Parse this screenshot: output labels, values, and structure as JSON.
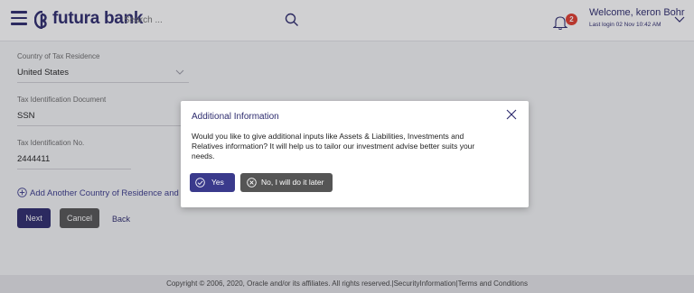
{
  "header": {
    "logo_text": "futura bank",
    "search_placeholder": "Search ...",
    "notification_count": "2",
    "welcome": "Welcome, keron Bohr",
    "last_login": "Last login 02 Nov 10:42 AM"
  },
  "form": {
    "country_label": "Country of Tax Residence",
    "country_value": "United States",
    "doc_label": "Tax Identification Document",
    "doc_value": "SSN",
    "tin_label": "Tax Identification No.",
    "tin_value": "2444411",
    "add_link": "Add Another Country of Residence and Tax",
    "next_label": "Next",
    "cancel_label": "Cancel",
    "back_label": "Back"
  },
  "modal": {
    "title": "Additional Information",
    "body": "Would you like to give additional inputs like Assets & Liabilities, Investments and Relatives information? It will help us to tailor our investment advise better suits your needs.",
    "yes_label": "Yes",
    "later_label": "No, I will do it later"
  },
  "footer": {
    "text": "Copyright © 2006, 2020, Oracle and/or its affiliates. All rights reserved.|SecurityInformation|Terms and Conditions"
  },
  "colors": {
    "brand": "#2d2b6e",
    "accent": "#3a3a8c",
    "badge": "#e03c2d",
    "secondary_button": "#555555"
  }
}
